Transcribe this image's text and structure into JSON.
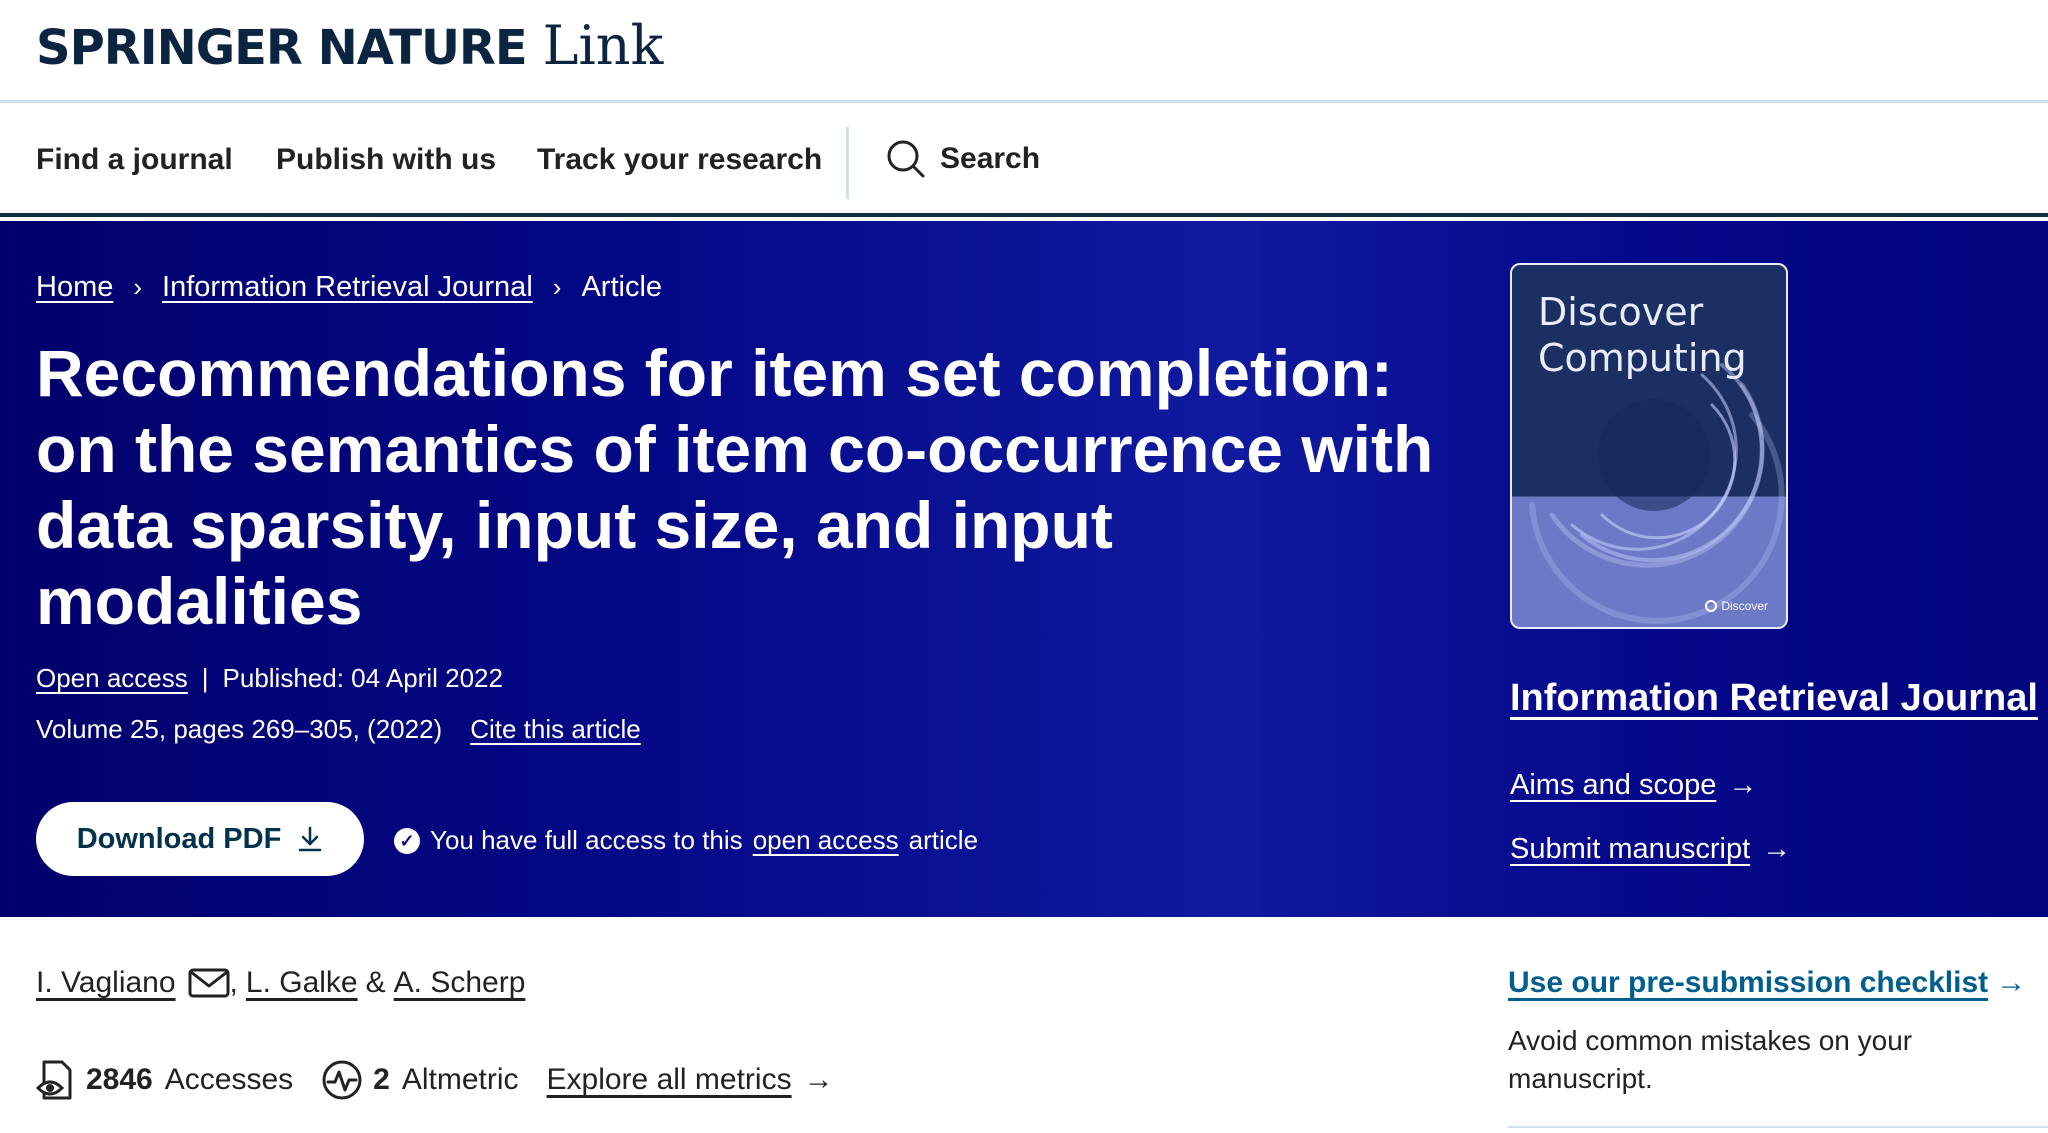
{
  "brand": {
    "name": "SPRINGER NATURE",
    "product": "Link"
  },
  "nav": {
    "items": [
      "Find a journal",
      "Publish with us",
      "Track your research"
    ],
    "search_label": "Search"
  },
  "breadcrumb": {
    "home": "Home",
    "journal": "Information Retrieval Journal",
    "current": "Article"
  },
  "article": {
    "title": "Recommendations for item set completion: on the semantics of item co-occurrence with data sparsity, input size, and input modalities",
    "open_access": "Open access",
    "separator": "|",
    "published": "Published: 04 April 2022",
    "volume": "Volume 25, pages 269–305, (2022)",
    "cite": "Cite this article",
    "download_label": "Download PDF",
    "access_prefix": "You have full access to this",
    "access_link": "open access",
    "access_suffix": "article"
  },
  "journal": {
    "cover_title_line1": "Discover",
    "cover_title_line2": "Computing",
    "cover_brand": "Discover",
    "name": "Information Retrieval Journal",
    "aims": "Aims and scope",
    "submit": "Submit manuscript"
  },
  "authors": {
    "a1": "I. Vagliano",
    "comma": ",",
    "a2": "L. Galke",
    "amp": "&",
    "a3": "A. Scherp"
  },
  "metrics": {
    "accesses_value": "2846",
    "accesses_label": "Accesses",
    "altmetric_value": "2",
    "altmetric_label": "Altmetric",
    "explore": "Explore all metrics"
  },
  "sidebar": {
    "checklist": "Use our pre-submission checklist",
    "avoid": "Avoid common mistakes on your manuscript."
  },
  "colors": {
    "hero_bg": "#050a8a",
    "nav_border": "#0d2f40",
    "link_blue": "#025e8d"
  }
}
